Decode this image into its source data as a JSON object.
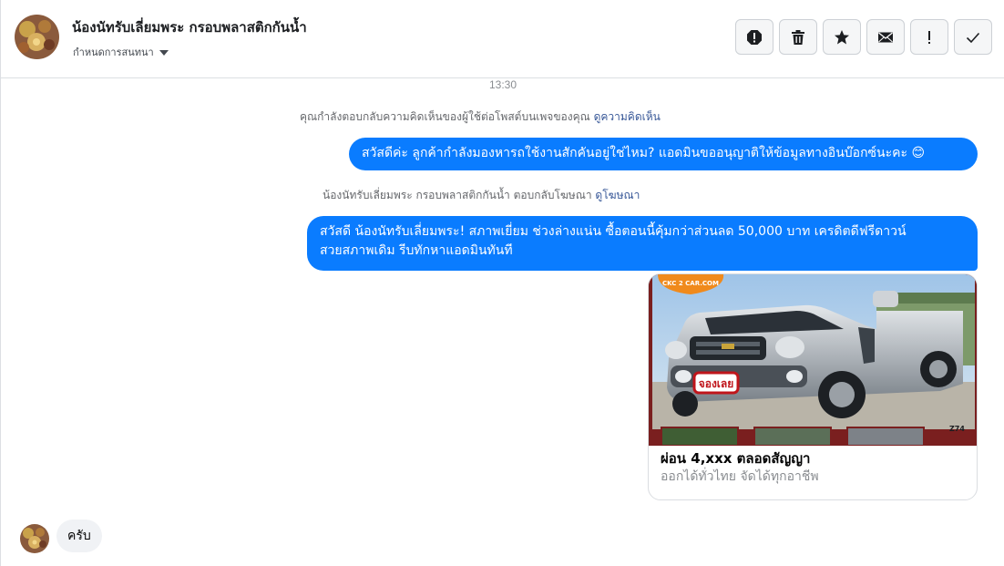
{
  "header": {
    "contact_name": "น้องนัทรับเลี่ยมพระ กรอบพลาสติกกันน้ำ",
    "status_label": "กำหนดการสนทนา"
  },
  "toolbar": {
    "buttons": [
      {
        "name": "report-spam-icon"
      },
      {
        "name": "trash-icon"
      },
      {
        "name": "star-icon"
      },
      {
        "name": "mail-icon"
      },
      {
        "name": "important-icon",
        "label": "!"
      },
      {
        "name": "check-icon"
      }
    ]
  },
  "thread": {
    "time": "13:30",
    "note1": {
      "text": "คุณกำลังตอบกลับความคิดเห็นของผู้ใช้ต่อโพสต์บนเพจของคุณ",
      "link": "ดูความคิดเห็น"
    },
    "msg1": "สวัสดีค่ะ ลูกค้ากำลังมองหารถใช้งานสักคันอยู่ใช่ไหม? แอดมินขออนุญาติให้ข้อมูลทางอินบ๊อกซ์นะคะ 😊",
    "note2": {
      "text": "น้องนัทรับเลี่ยมพระ กรอบพลาสติกกันน้ำ ตอบกลับโฆษณา",
      "link": "ดูโฆษณา"
    },
    "msg2_line1": "สวัสดี น้องนัทรับเลี่ยมพระ!  สภาพเยี่ยม ช่วงล่างแน่น  ซื้อตอนนี้คุ้มกว่าส่วนลด 50,000 บาท เครดิตดีฟรีดาวน์",
    "msg2_line2": "สวยสภาพเดิม รีบทักหาแอดมินทันที",
    "card": {
      "logo_text": "CKC 2 CAR.COM",
      "sticker_text": "จองเลย",
      "plate_text": "Z74",
      "title": "ผ่อน 4,xxx ตลอดสัญญา",
      "subtitle": "ออกได้ทั่วไทย จัดได้ทุกอาชีพ"
    },
    "reply": "ครับ"
  },
  "colors": {
    "accent": "#0a7cff",
    "link": "#385898",
    "incoming_bg": "#f0f2f5"
  }
}
